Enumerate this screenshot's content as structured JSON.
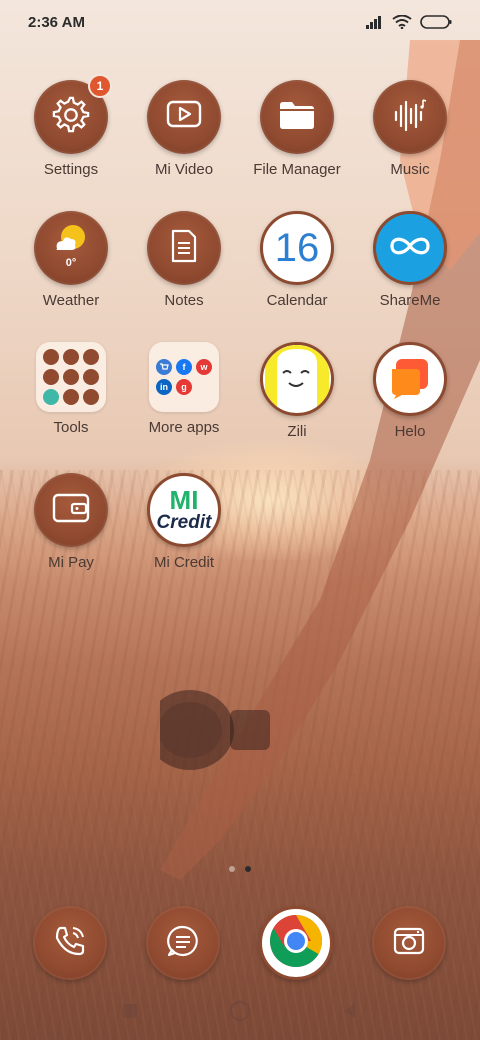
{
  "status_bar": {
    "time": "2:36 AM",
    "icons": [
      "signal-icon",
      "wifi-icon",
      "battery-icon"
    ]
  },
  "apps": [
    {
      "label": "Settings",
      "icon": "gear-icon",
      "badge": "1"
    },
    {
      "label": "Mi Video",
      "icon": "play-icon"
    },
    {
      "label": "File Manager",
      "icon": "folder-icon"
    },
    {
      "label": "Music",
      "icon": "sound-wave-icon"
    },
    {
      "label": "Weather",
      "icon": "weather-icon",
      "temp": "0°"
    },
    {
      "label": "Notes",
      "icon": "note-icon"
    },
    {
      "label": "Calendar",
      "icon": "calendar-icon",
      "day": "16"
    },
    {
      "label": "ShareMe",
      "icon": "infinity-icon"
    },
    {
      "label": "Tools",
      "icon": "folder-grid-icon"
    },
    {
      "label": "More apps",
      "icon": "folder-grid-icon"
    },
    {
      "label": "Zili",
      "icon": "zili-face-icon"
    },
    {
      "label": "Helo",
      "icon": "helo-chat-icon"
    },
    {
      "label": "Mi Pay",
      "icon": "wallet-icon"
    },
    {
      "label": "Mi Credit",
      "icon": "mi-credit-icon",
      "logo_top": "MI",
      "logo_bottom": "Credit"
    }
  ],
  "more_apps_folder": {
    "minis": [
      {
        "icon": "cart-icon",
        "color": "#3a7bd5"
      },
      {
        "icon": "facebook-icon",
        "color": "#1877f2",
        "glyph": "f"
      },
      {
        "icon": "wynk-icon",
        "color": "#e53935",
        "glyph": "w"
      },
      {
        "icon": "linkedin-icon",
        "color": "#0a66c2",
        "glyph": "in"
      },
      {
        "icon": "g-icon",
        "color": "#e53935",
        "glyph": "g"
      }
    ]
  },
  "page_indicator": {
    "count": 2,
    "active": 1
  },
  "dock": [
    {
      "icon": "phone-icon"
    },
    {
      "icon": "message-icon"
    },
    {
      "icon": "chrome-icon"
    },
    {
      "icon": "camera-icon"
    }
  ],
  "nav_bar": [
    "recents-icon",
    "home-icon",
    "back-icon"
  ],
  "colors": {
    "icon_brown": "#8f4a30",
    "badge": "#e0562f",
    "label": "#4a3a34"
  }
}
